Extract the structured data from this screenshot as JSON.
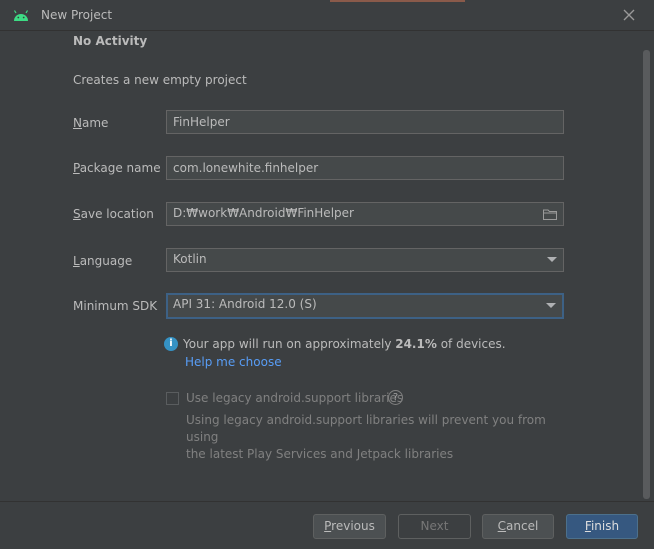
{
  "window": {
    "title": "New Project",
    "app_icon": "android-icon",
    "close_icon": "close-icon"
  },
  "page": {
    "heading": "No Activity",
    "description": "Creates a new empty project"
  },
  "form": {
    "name": {
      "label_mnemonic": "N",
      "label_rest": "ame",
      "value": "FinHelper"
    },
    "package": {
      "label_mnemonic": "P",
      "label_rest": "ackage name",
      "value": "com.lonewhite.finhelper"
    },
    "save_location": {
      "label_mnemonic": "S",
      "label_rest": "ave location",
      "value": "D:₩work₩Android₩FinHelper",
      "icon": "folder-icon"
    },
    "language": {
      "label_mnemonic": "L",
      "label_rest": "anguage",
      "value": "Kotlin"
    },
    "min_sdk": {
      "label": "Minimum SDK",
      "value": "API 31: Android 12.0 (S)"
    }
  },
  "info": {
    "icon": "info-icon",
    "text_before": "Your app will run on approximately ",
    "percent": "24.1%",
    "text_after": " of devices.",
    "help_link": "Help me choose"
  },
  "legacy": {
    "checked": false,
    "label": "Use legacy android.support libraries",
    "help_icon": "question-icon",
    "note_line1": "Using legacy android.support libraries will prevent you from using",
    "note_line2": "the latest Play Services and Jetpack libraries"
  },
  "buttons": {
    "previous": {
      "mnemonic": "P",
      "rest": "revious"
    },
    "next": {
      "label": "Next"
    },
    "cancel": {
      "mnemonic": "C",
      "rest": "ancel"
    },
    "finish": {
      "mnemonic": "F",
      "rest": "inish"
    }
  },
  "colors": {
    "background": "#3c3f41",
    "field": "#45494a",
    "focus": "#3d6185",
    "link": "#589df6",
    "primary_button": "#365880"
  }
}
